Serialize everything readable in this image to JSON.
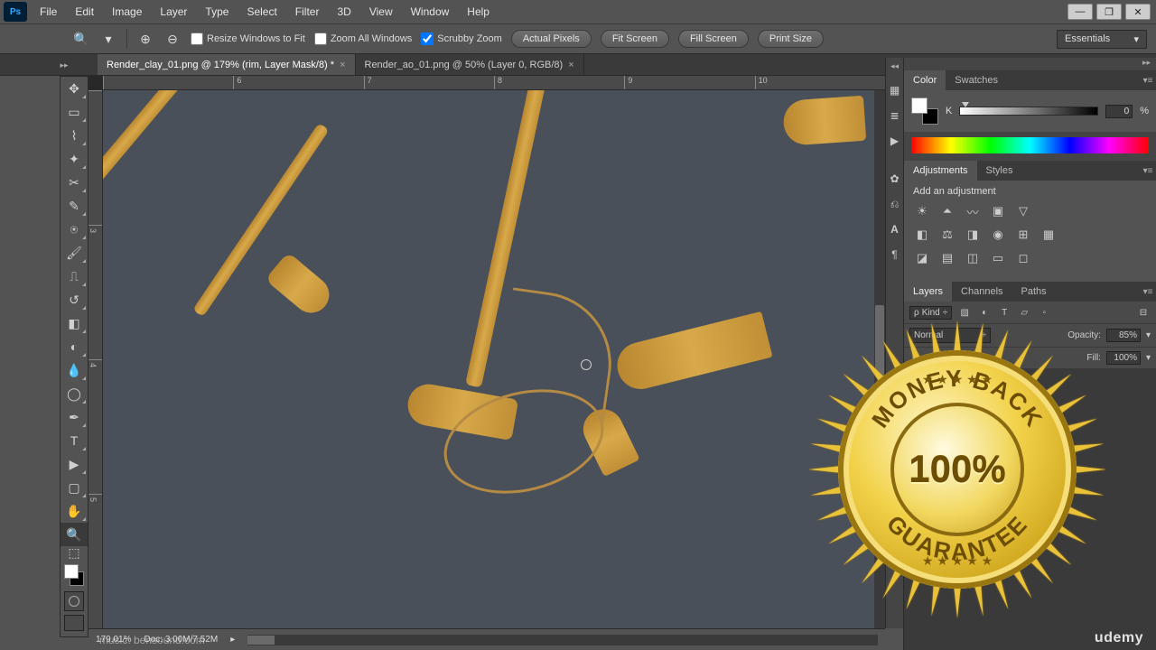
{
  "app": {
    "short": "Ps"
  },
  "menus": [
    "File",
    "Edit",
    "Image",
    "Layer",
    "Type",
    "Select",
    "Filter",
    "3D",
    "View",
    "Window",
    "Help"
  ],
  "options": {
    "resize_fit": "Resize Windows to Fit",
    "zoom_all": "Zoom All Windows",
    "scrubby": "Scrubby Zoom",
    "actual": "Actual Pixels",
    "fit": "Fit Screen",
    "fill": "Fill Screen",
    "print": "Print Size",
    "workspace": "Essentials"
  },
  "tabs": [
    {
      "label": "Render_clay_01.png @ 179% (rim, Layer Mask/8) *"
    },
    {
      "label": "Render_ao_01.png @ 50% (Layer 0, RGB/8)"
    }
  ],
  "ruler_h": [
    "",
    "6",
    "7",
    "8",
    "9",
    "10"
  ],
  "ruler_v": [
    "",
    "3",
    "4",
    "5"
  ],
  "panels": {
    "color_tab": "Color",
    "swatches_tab": "Swatches",
    "k_label": "K",
    "k_value": "0",
    "k_pct": "%",
    "adjustments_tab": "Adjustments",
    "styles_tab": "Styles",
    "add_adjustment": "Add an adjustment",
    "layers_tab": "Layers",
    "channels_tab": "Channels",
    "paths_tab": "Paths",
    "kind_label": "Kind",
    "blend_mode": "Normal",
    "opacity_label": "Opacity:",
    "opacity_val": "85%",
    "fill_label": "Fill:",
    "fill_val": "100%"
  },
  "status": {
    "zoom": "179.01%",
    "doc": "Doc: 3.00M/7.52M"
  },
  "seal": {
    "top": "MONEY BACK",
    "bottom": "GUARANTEE",
    "center": "100%"
  },
  "credits": {
    "udemy": "udemy",
    "music": "music: bensound.com"
  }
}
